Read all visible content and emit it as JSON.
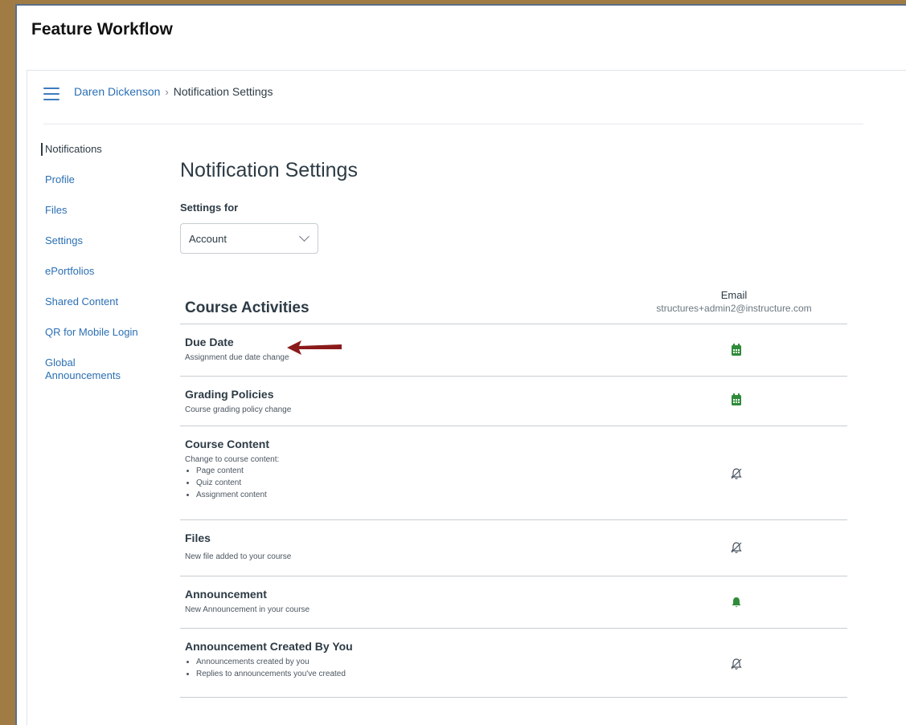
{
  "page_heading": "Feature Workflow",
  "breadcrumb": {
    "user": "Daren Dickenson",
    "separator": "›",
    "current": "Notification Settings"
  },
  "sidebar": {
    "items": [
      {
        "label": "Notifications"
      },
      {
        "label": "Profile"
      },
      {
        "label": "Files"
      },
      {
        "label": "Settings"
      },
      {
        "label": "ePortfolios"
      },
      {
        "label": "Shared Content"
      },
      {
        "label": "QR for Mobile Login"
      },
      {
        "label": "Global Announcements"
      }
    ]
  },
  "main": {
    "title": "Notification Settings",
    "settings_for_label": "Settings for",
    "settings_for_value": "Account"
  },
  "table": {
    "section_title": "Course Activities",
    "column_header": "Email",
    "column_subheader": "structures+admin2@instructure.com",
    "rows": [
      {
        "title": "Due Date",
        "desc": "Assignment due date change",
        "icon": "calendar-icon"
      },
      {
        "title": "Grading Policies",
        "desc": "Course grading policy change",
        "icon": "calendar-icon"
      },
      {
        "title": "Course Content",
        "desc": "Change to course content:",
        "bullets": [
          "Page content",
          "Quiz content",
          "Assignment content"
        ],
        "icon": "bell-off-icon"
      },
      {
        "title": "Files",
        "desc": "New file added to your course",
        "icon": "bell-off-icon"
      },
      {
        "title": "Announcement",
        "desc": "New Announcement in your course",
        "icon": "bell-icon"
      },
      {
        "title": "Announcement Created By You",
        "bullets": [
          "Announcements created by you",
          "Replies to announcements you've created"
        ],
        "icon": "bell-off-icon"
      }
    ]
  },
  "colors": {
    "link": "#2b6fb3",
    "active_green": "#2e8b3a",
    "arrow": "#8b1a1a",
    "border_frame": "#a07c44"
  }
}
